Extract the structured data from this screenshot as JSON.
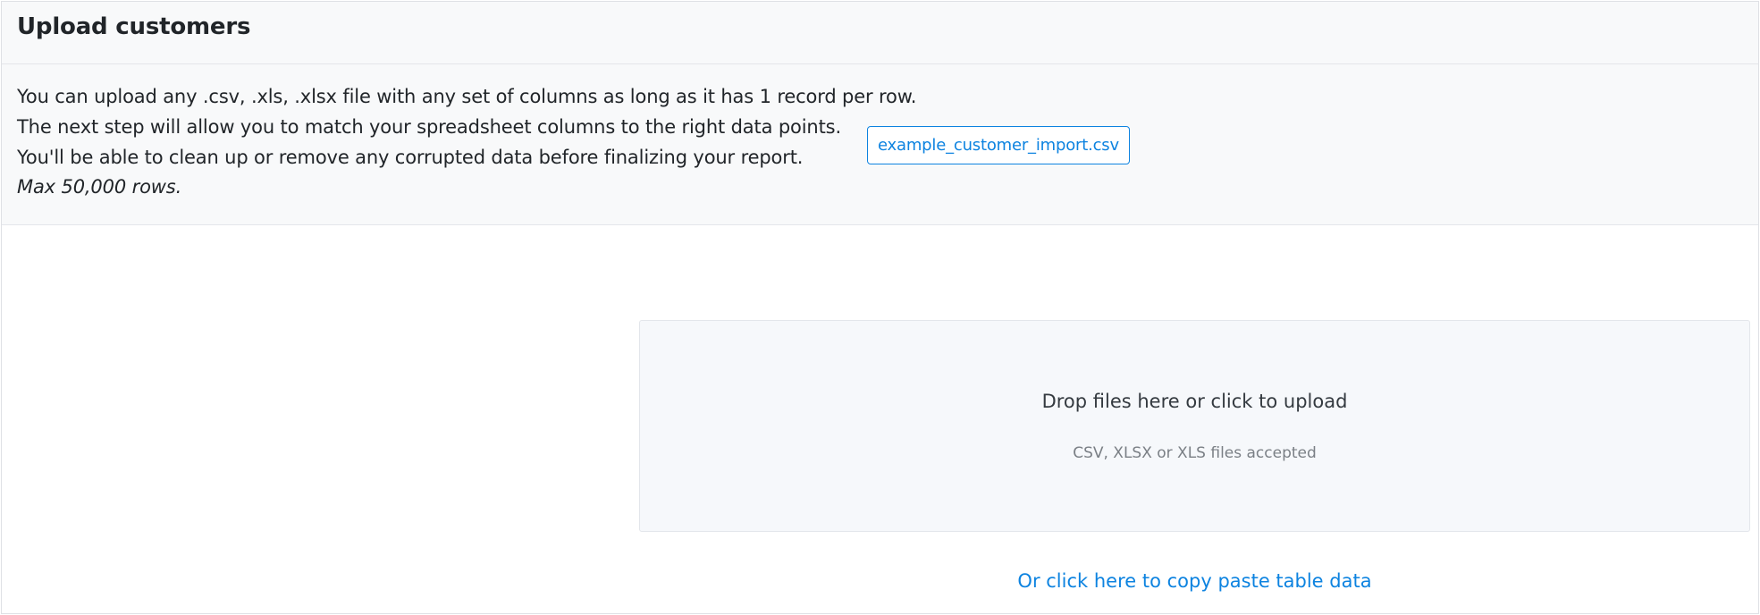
{
  "header": {
    "title": "Upload customers"
  },
  "info": {
    "lines": [
      "You can upload any .csv, .xls, .xlsx file with any set of columns as long as it has 1 record per row.",
      "The next step will allow you to match your spreadsheet columns to the right data points.",
      "You'll be able to clean up or remove any corrupted data before finalizing your report.",
      "Max 50,000 rows."
    ],
    "example_button_label": "example_customer_import.csv"
  },
  "dropzone": {
    "title": "Drop files here or click to upload",
    "subtitle": "CSV, XLSX or XLS files accepted"
  },
  "paste_link": {
    "label": "Or click here to copy paste table data"
  },
  "colors": {
    "accent": "#0d83e0",
    "header_bg": "#f8f9fa",
    "dropzone_bg": "#f6f8fb"
  }
}
